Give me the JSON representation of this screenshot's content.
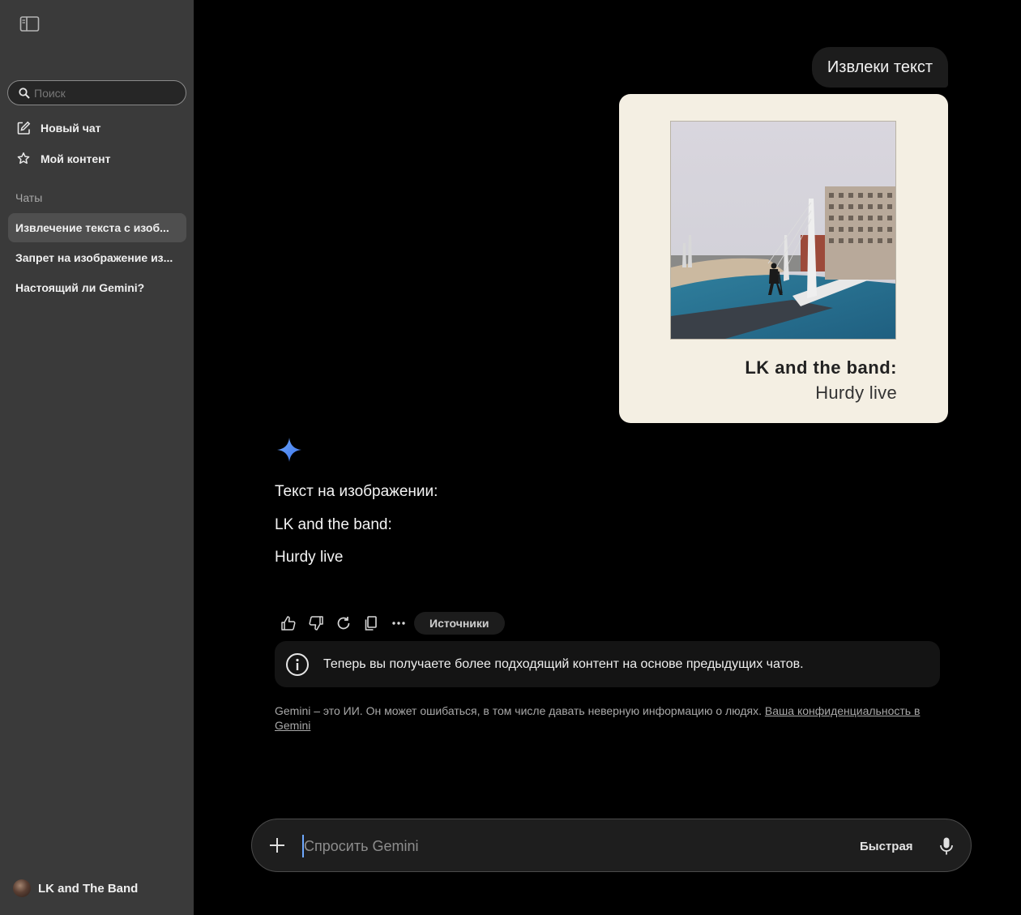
{
  "sidebar": {
    "toggle_icon": "sidebar-toggle-icon",
    "search": {
      "placeholder": "Поиск",
      "value": ""
    },
    "new_chat_label": "Новый чат",
    "my_content_label": "Мой контент",
    "chats_heading": "Чаты",
    "chats": [
      {
        "title": "Извлечение текста с изоб..."
      },
      {
        "title": "Запрет на изображение из..."
      },
      {
        "title": "Настоящий ли Gemini?"
      }
    ],
    "account_name": "LK and The Band"
  },
  "conversation": {
    "user_message": "Извлеки текст",
    "attachment": {
      "title": "LK and the band:",
      "subtitle": "Hurdy live"
    },
    "response": {
      "lines": [
        "Текст на изображении:",
        "LK and the band:",
        "Hurdy live"
      ]
    },
    "actions": {
      "icons": [
        "thumbs-up-icon",
        "thumbs-down-icon",
        "regenerate-icon",
        "copy-icon",
        "more-icon"
      ],
      "sources_label": "Источники"
    },
    "info_notice": "Теперь вы получаете более подходящий контент на основе предыдущих чатов.",
    "disclaimer_text": "Gemini – это ИИ. Он может ошибаться, в том числе давать неверную информацию о людях. ",
    "disclaimer_link": "Ваша конфиденциальность в Gemini"
  },
  "composer": {
    "placeholder": "Спросить Gemini",
    "value": "",
    "mode_label": "Быстрая"
  },
  "colors": {
    "sidebar_bg": "#3a3a3a",
    "main_bg": "#000000",
    "card_bg": "#f4efe3",
    "spark": "#4d8df6",
    "caret": "#6ea8ff"
  }
}
